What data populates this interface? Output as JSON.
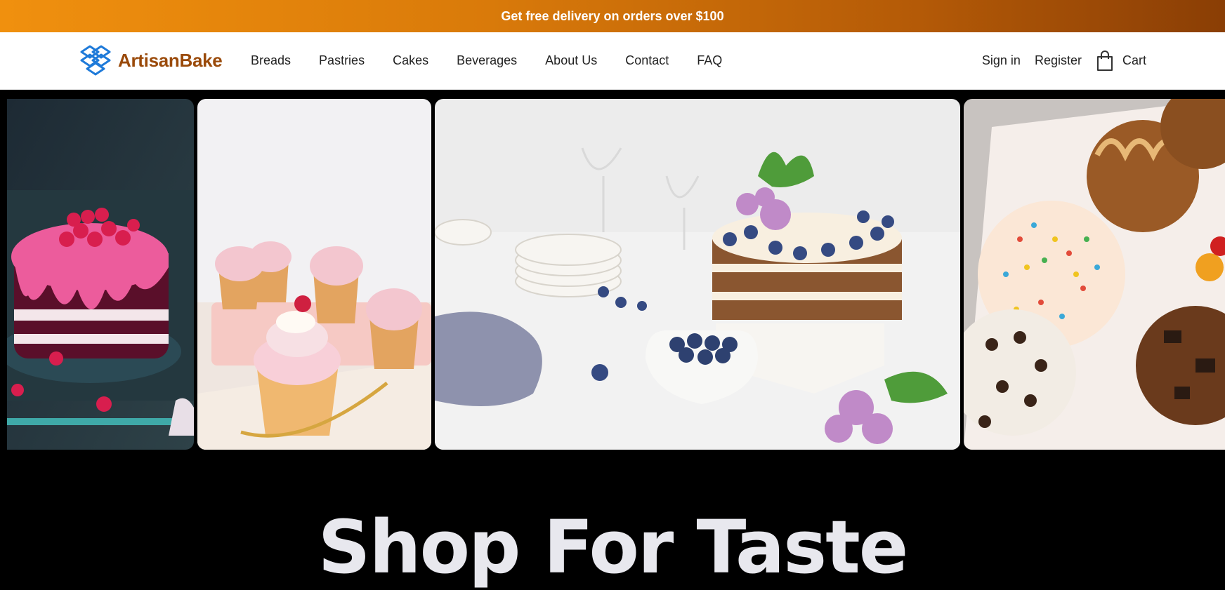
{
  "promo": {
    "text": "Get free delivery on orders over $100"
  },
  "brand": {
    "name": "ArtisanBake",
    "logo_icon": "stacked-diamond-logo",
    "color": "#9a4a0a"
  },
  "nav": {
    "links": [
      "Breads",
      "Pastries",
      "Cakes",
      "Beverages",
      "About Us",
      "Contact",
      "FAQ"
    ],
    "sign_in": "Sign in",
    "register": "Register",
    "cart": "Cart",
    "cart_icon": "shopping-bag-icon"
  },
  "gallery": {
    "images": [
      {
        "name": "raspberry-drip-cake"
      },
      {
        "name": "strawberry-cupcakes"
      },
      {
        "name": "blueberry-naked-cake"
      },
      {
        "name": "sprinkle-donuts"
      }
    ]
  },
  "hero": {
    "title": "Shop For Taste"
  },
  "colors": {
    "promo_start": "#f0900e",
    "promo_end": "#8a3e05",
    "accent": "#1e7ad9"
  }
}
